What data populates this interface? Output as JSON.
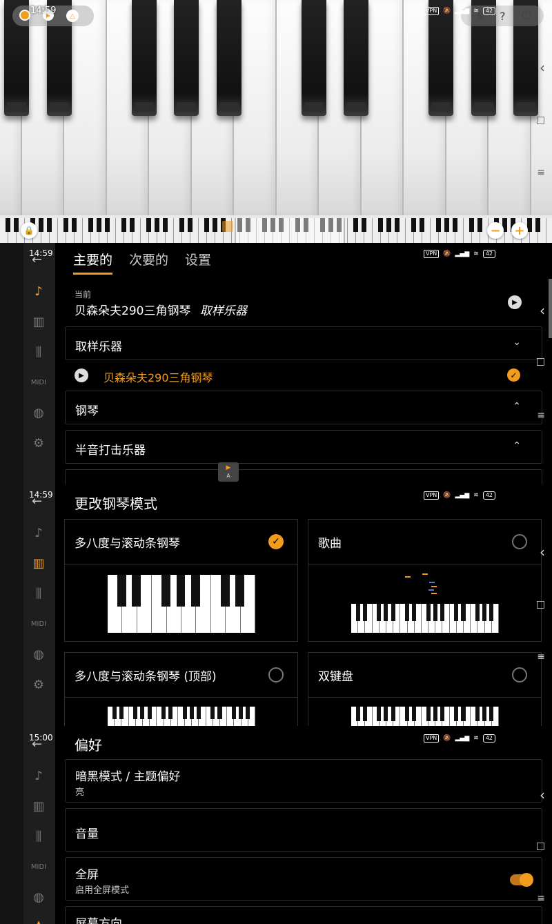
{
  "status_bar": {
    "time_1": "14:59",
    "time_2": "14:59",
    "time_3": "14:59",
    "time_4": "15:00",
    "vpn": "VPN",
    "net": "5G",
    "battery": "42"
  },
  "piano_panel": {
    "zoom_out_symbol": "−",
    "zoom_in_symbol": "+",
    "lock_symbol": "🔒",
    "mode_marker": "A"
  },
  "tabs": [
    {
      "label": "主要的",
      "active": true
    },
    {
      "label": "次要的",
      "active": false
    },
    {
      "label": "设置",
      "active": false
    }
  ],
  "current": {
    "caption": "当前",
    "instrument": "贝森朵夫290三角钢琴",
    "category_italic": "取样乐器"
  },
  "instrument_groups": [
    {
      "label": "取样乐器",
      "expanded": true
    },
    {
      "label": "钢琴",
      "expanded": false
    },
    {
      "label": "半音打击乐器",
      "expanded": false
    }
  ],
  "selected_instrument": "贝森朵夫290三角钢琴",
  "rail_items": [
    "instrument",
    "keyboard",
    "mixer",
    "MIDI",
    "globe",
    "settings"
  ],
  "rail_midi_label": "MIDI",
  "piano_mode": {
    "section_title": "更改钢琴模式",
    "modes": [
      {
        "label": "多八度与滚动条钢琴",
        "selected": true
      },
      {
        "label": "歌曲",
        "selected": false
      },
      {
        "label": "多八度与滚动条钢琴 (顶部)",
        "selected": false
      },
      {
        "label": "双键盘",
        "selected": false
      }
    ]
  },
  "preferences": {
    "section_title": "偏好",
    "items": [
      {
        "title": "暗黑模式 / 主题偏好",
        "subtitle": "亮"
      },
      {
        "title": "音量",
        "subtitle": ""
      },
      {
        "title": "全屏",
        "subtitle": "启用全屏模式",
        "toggle_on": true
      },
      {
        "title": "屏幕方向",
        "subtitle": ""
      }
    ]
  },
  "colors": {
    "accent": "#f29c1f",
    "background": "#000000",
    "card_border": "#2f2f2f"
  }
}
